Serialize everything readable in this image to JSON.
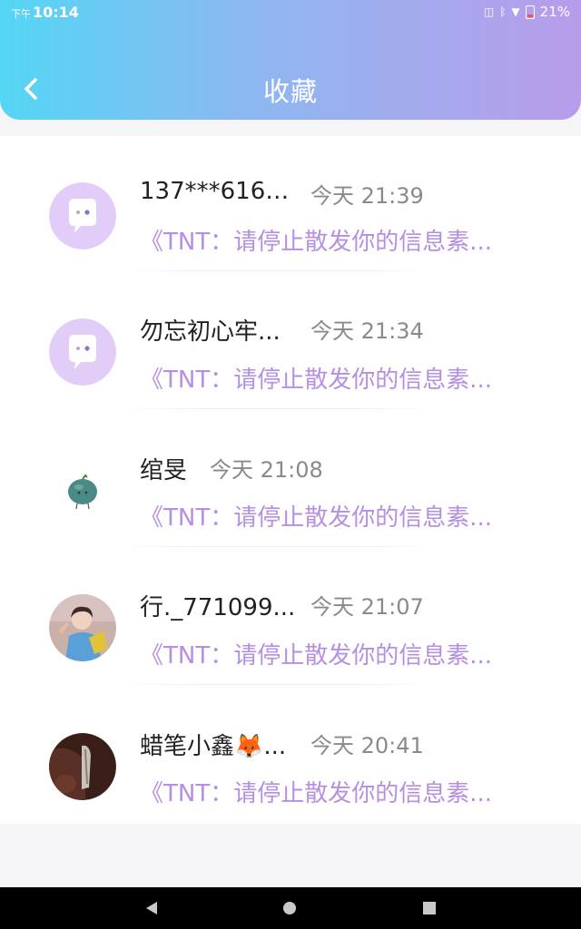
{
  "status_bar": {
    "ampm": "下午",
    "time": "10:14",
    "battery": "21%"
  },
  "header": {
    "title": "收藏",
    "back_icon": "chevron-left-icon"
  },
  "colors": {
    "header_gradient_start": "#54d6f5",
    "header_gradient_end": "#b99cec",
    "preview_text": "#b68fe2",
    "avatar_bubble_bg": "#e2cdf9"
  },
  "favorites": [
    {
      "name": "137***616_...",
      "time": "今天 21:39",
      "preview": "《TNT：请停止散发你的信息素...",
      "avatar": "chat-bubble-avatar"
    },
    {
      "name": "勿忘初心牢...",
      "time": "今天 21:34",
      "preview": "《TNT：请停止散发你的信息素...",
      "avatar": "chat-bubble-avatar"
    },
    {
      "name": "绾旻",
      "time": "今天 21:08",
      "preview": "《TNT：请停止散发你的信息素...",
      "avatar": "green-fruit-avatar"
    },
    {
      "name": "行._771099...",
      "time": "今天 21:07",
      "preview": "《TNT：请停止散发你的信息素...",
      "avatar": "photo-avatar"
    },
    {
      "name": "蜡笔小鑫🦊...",
      "time": "今天 20:41",
      "preview": "《TNT：请停止散发你的信息素...",
      "avatar": "dark-photo-avatar"
    }
  ],
  "nav_bar": {
    "back": "nav-back-icon",
    "home": "nav-home-icon",
    "recents": "nav-recents-icon"
  }
}
